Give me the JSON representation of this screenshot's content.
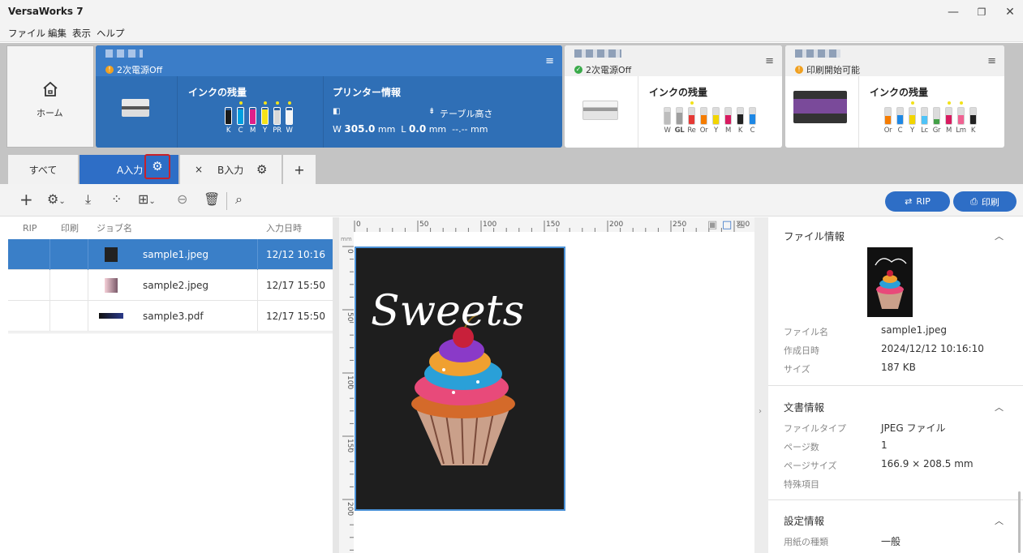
{
  "app": {
    "title": "VersaWorks 7",
    "win_min": "—",
    "win_restore": "❐",
    "win_close": "✕"
  },
  "menu": [
    "ファイル",
    "編集",
    "表示",
    "ヘルプ"
  ],
  "home": {
    "label": "ホーム"
  },
  "printers": [
    {
      "status": "2次電源Off",
      "status_color": "#f0a020",
      "ink_title": "インクの残量",
      "info_title": "プリンター情報",
      "table_height_label": "テーブル高さ",
      "width_prefix": "W",
      "width_value": "305.0",
      "width_unit": "mm",
      "length_prefix": "L",
      "length_value": "0.0",
      "length_unit": "mm",
      "height_value": "--.--",
      "height_unit": "mm",
      "inks": [
        {
          "label": "K",
          "color": "#1a1a1a",
          "level": 0.85,
          "dot": false
        },
        {
          "label": "C",
          "color": "#00a0e0",
          "level": 0.9,
          "dot": true
        },
        {
          "label": "M",
          "color": "#e0208a",
          "level": 0.9,
          "dot": false
        },
        {
          "label": "Y",
          "color": "#f5e21a",
          "level": 0.9,
          "dot": true
        },
        {
          "label": "PR",
          "color": "#d8d8d8",
          "level": 0.85,
          "dot": true
        },
        {
          "label": "W",
          "color": "#f5f5f5",
          "level": 0.85,
          "dot": true
        }
      ]
    },
    {
      "status": "2次電源Off",
      "status_color": "#3aaa4a",
      "ink_title": "インクの残量",
      "inks": [
        {
          "label": "W",
          "color": "#bdbdbd",
          "level": 0.75,
          "dot": false
        },
        {
          "label": "GL",
          "color": "#9e9e9e",
          "level": 0.7,
          "dot": false
        },
        {
          "label": "Re",
          "color": "#e53935",
          "level": 0.55,
          "dot": true
        },
        {
          "label": "Or",
          "color": "#f57c00",
          "level": 0.55,
          "dot": false
        },
        {
          "label": "Y",
          "color": "#f2d500",
          "level": 0.55,
          "dot": false
        },
        {
          "label": "M",
          "color": "#d81b60",
          "level": 0.55,
          "dot": false
        },
        {
          "label": "K",
          "color": "#222222",
          "level": 0.6,
          "dot": false
        },
        {
          "label": "C",
          "color": "#1e88e5",
          "level": 0.6,
          "dot": false
        }
      ]
    },
    {
      "status": "印刷開始可能",
      "status_color": "#f0a020",
      "ink_title": "インクの残量",
      "inks": [
        {
          "label": "Or",
          "color": "#f57c00",
          "level": 0.5,
          "dot": false
        },
        {
          "label": "C",
          "color": "#1e88e5",
          "level": 0.55,
          "dot": false
        },
        {
          "label": "Y",
          "color": "#f2d500",
          "level": 0.55,
          "dot": true
        },
        {
          "label": "Lc",
          "color": "#4fc3f7",
          "level": 0.5,
          "dot": false
        },
        {
          "label": "Gr",
          "color": "#43a047",
          "level": 0.3,
          "dot": false
        },
        {
          "label": "M",
          "color": "#d81b60",
          "level": 0.55,
          "dot": true
        },
        {
          "label": "Lm",
          "color": "#f06292",
          "level": 0.55,
          "dot": true
        },
        {
          "label": "K",
          "color": "#222222",
          "level": 0.55,
          "dot": false
        }
      ]
    }
  ],
  "tabs": {
    "all": "すべて",
    "a": "A入力",
    "close": "×",
    "b": "B入力",
    "add": "+"
  },
  "toolbar": {
    "rip": "RIP",
    "print": "印刷"
  },
  "joblist": {
    "headers": {
      "rip": "RIP",
      "print": "印刷",
      "name": "ジョブ名",
      "date": "入力日時"
    },
    "rows": [
      {
        "name": "sample1.jpeg",
        "date": "12/12 10:16",
        "selected": true
      },
      {
        "name": "sample2.jpeg",
        "date": "12/17 15:50",
        "selected": false
      },
      {
        "name": "sample3.pdf",
        "date": "12/17 15:50",
        "selected": false
      }
    ]
  },
  "preview": {
    "unit": "mm",
    "hticks": [
      "0",
      "50",
      "100",
      "150",
      "200",
      "250",
      "300"
    ],
    "vticks": [
      "0",
      "50",
      "100",
      "150",
      "200"
    ],
    "artwork_text": "Sweets"
  },
  "fileinfo": {
    "title": "ファイル情報",
    "name_label": "ファイル名",
    "name": "sample1.jpeg",
    "created_label": "作成日時",
    "created": "2024/12/12 10:16:10",
    "size_label": "サイズ",
    "size": "187 KB"
  },
  "docinfo": {
    "title": "文書情報",
    "type_label": "ファイルタイプ",
    "type": "JPEG ファイル",
    "pages_label": "ページ数",
    "pages": "1",
    "pagesize_label": "ページサイズ",
    "pagesize": "166.9 × 208.5 mm",
    "special_label": "特殊項目"
  },
  "settings": {
    "title": "設定情報",
    "media_label": "用紙の種類",
    "media": "一般"
  }
}
